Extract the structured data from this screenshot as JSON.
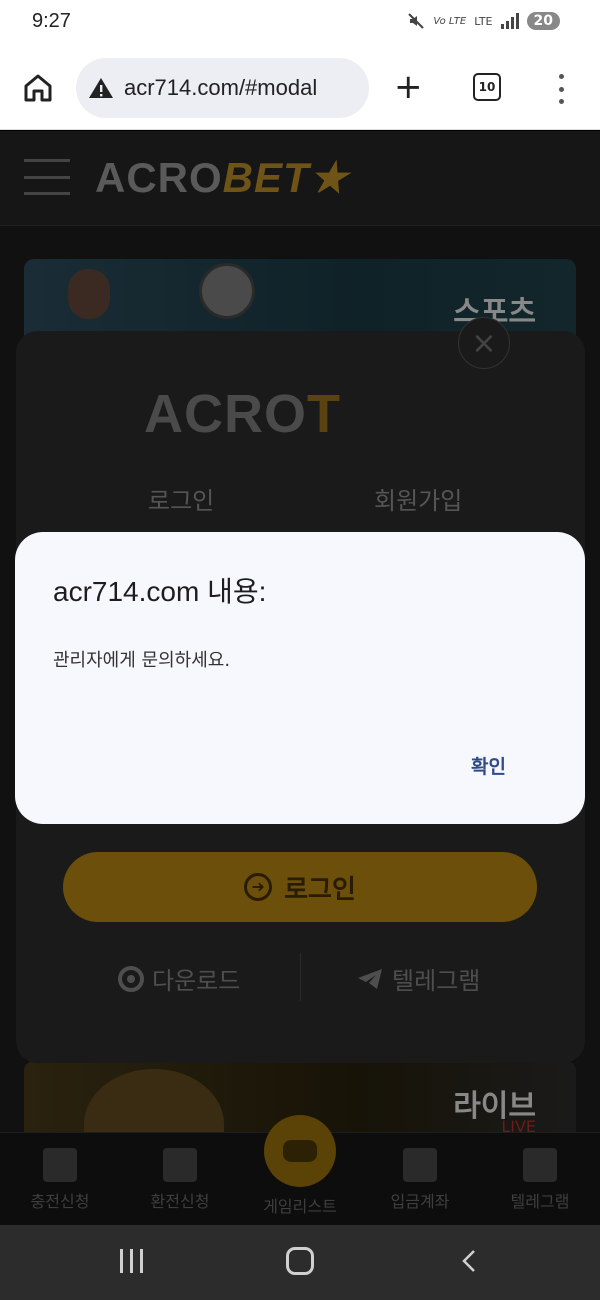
{
  "status_bar": {
    "time": "9:27",
    "network": "LTE",
    "volte": "Vo LTE",
    "battery": "20"
  },
  "browser": {
    "url": "acr714.com/#modal",
    "tab_count": "10"
  },
  "site": {
    "logo_part1": "ACRO",
    "logo_part2": "BET★",
    "banners": [
      {
        "title": "스포츠"
      },
      {
        "title": "라이브",
        "subtitle": "LIVE"
      }
    ]
  },
  "login_modal": {
    "logo_part1": "ACRO",
    "logo_part2": "T",
    "close_glyph": "×",
    "tabs": [
      "로그인",
      "회원가입"
    ],
    "login_button": "로그인",
    "download_label": "다운로드",
    "telegram_label": "텔레그램"
  },
  "bottom_nav": {
    "items": [
      "충전신청",
      "환전신청",
      "게임리스트",
      "입금계좌",
      "텔레그램"
    ]
  },
  "alert": {
    "title": "acr714.com 내용:",
    "message": "관리자에게 문의하세요.",
    "ok_button": "확인"
  }
}
